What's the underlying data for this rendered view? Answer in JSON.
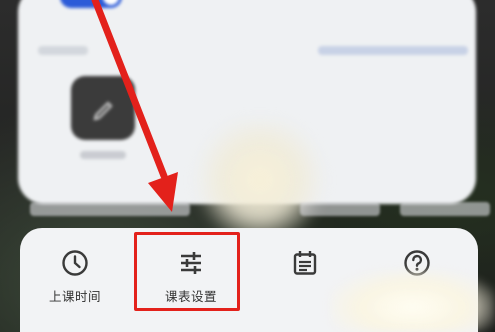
{
  "colors": {
    "accent_red": "#e3211b",
    "toggle_blue": "#2c5bd8",
    "panel_bg": "#f2f3f5",
    "icon_color": "#3a3a3a"
  },
  "bottom_menu": {
    "items": [
      {
        "label": "上课时间",
        "icon": "clock-icon"
      },
      {
        "label": "课表设置",
        "icon": "sliders-icon"
      },
      {
        "label": "",
        "icon": "calendar-icon"
      },
      {
        "label": "",
        "icon": "help-icon"
      }
    ],
    "highlighted_index": 1
  },
  "annotation": {
    "arrow": "red-arrow-icon",
    "box": "highlight-box"
  }
}
